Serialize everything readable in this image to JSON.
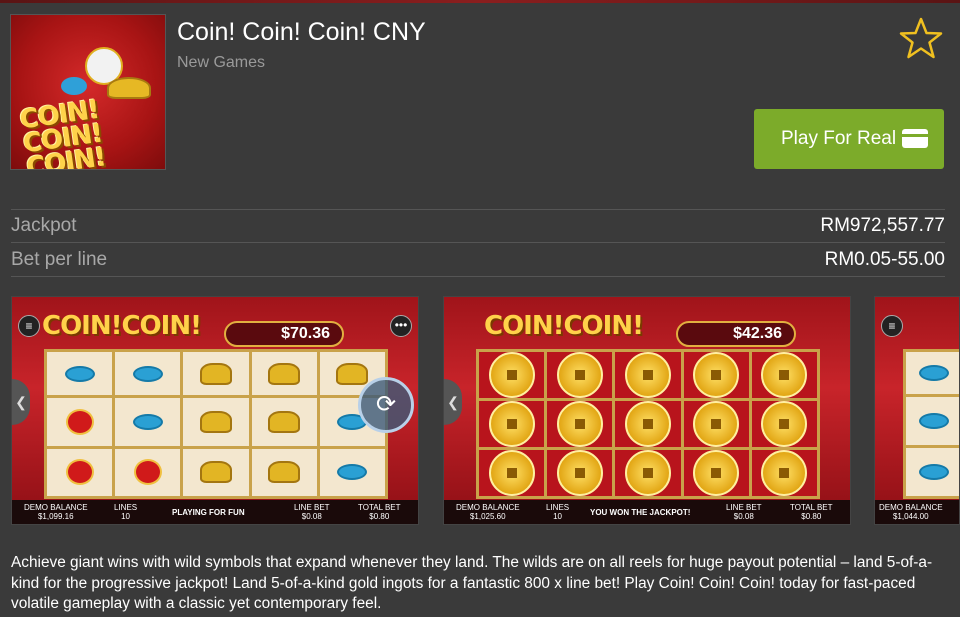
{
  "game": {
    "title": "Coin! Coin! Coin! CNY",
    "category": "New Games",
    "logo_text": "COIN! COIN! COIN!"
  },
  "actions": {
    "play_label": "Play For Real",
    "favorite_icon": "star-outline-icon",
    "card_icon": "credit-card-icon"
  },
  "stats": [
    {
      "label": "Jackpot",
      "value": "RM972,557.77"
    },
    {
      "label": "Bet per line",
      "value": "RM0.05-55.00"
    }
  ],
  "screenshots": [
    {
      "balance": "$70.36",
      "demo_balance_label": "DEMO BALANCE",
      "demo_balance": "$1,099.16",
      "lines_label": "LINES",
      "lines": "10",
      "message": "PLAYING FOR FUN",
      "line_bet_label": "LINE BET",
      "line_bet": "$0.08",
      "total_bet_label": "TOTAL BET",
      "total_bet": "$0.80"
    },
    {
      "balance": "$42.36",
      "demo_balance_label": "DEMO BALANCE",
      "demo_balance": "$1,025.60",
      "lines_label": "LINES",
      "lines": "10",
      "message": "YOU WON THE JACKPOT!",
      "line_bet_label": "LINE BET",
      "line_bet": "$0.08",
      "total_bet_label": "TOTAL BET",
      "total_bet": "$0.80"
    },
    {
      "demo_balance_label": "DEMO BALANCE",
      "demo_balance": "$1,044.00"
    }
  ],
  "description": "Achieve giant wins with wild symbols that expand whenever they land. The wilds are on all reels for huge payout potential – land 5-of-a-kind for the progressive jackpot! Land 5-of-a-kind gold ingots for a fantastic 800 x line bet! Play Coin! Coin! Coin! today for fast-paced volatile gameplay with a classic yet contemporary feel.",
  "colors": {
    "background": "#3a3a3a",
    "play_button": "#7cab2a",
    "star": "#f0c020"
  }
}
